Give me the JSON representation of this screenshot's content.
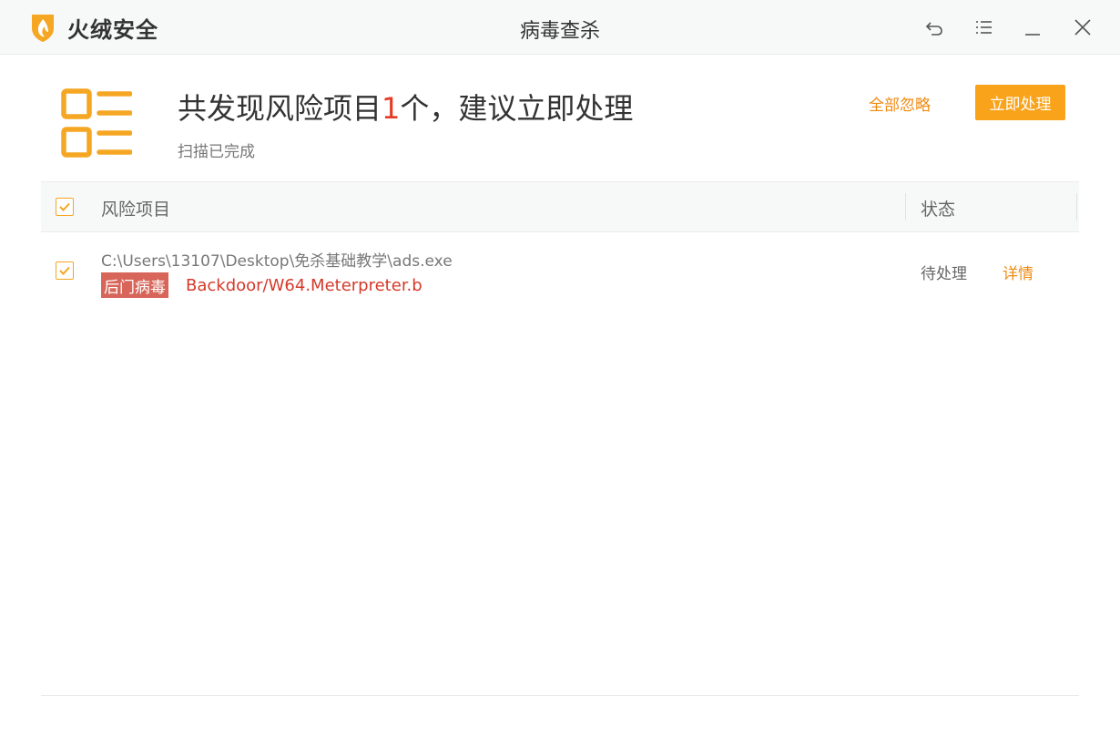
{
  "app": {
    "brand_name": "火绒安全",
    "window_title": "病毒查杀",
    "brand_color": "#f5a623"
  },
  "window_controls": {
    "back": "undo-arrow-icon",
    "menu": "menu-icon",
    "minimize": "minimize-icon",
    "close": "close-icon"
  },
  "summary": {
    "title_prefix": "共发现风险项目",
    "count": "1",
    "title_suffix": "个，建议立即处理",
    "subtitle": "扫描已完成",
    "ignore_all_label": "全部忽略",
    "process_now_label": "立即处理"
  },
  "table": {
    "header_checked": true,
    "columns": [
      "风险项目",
      "状态"
    ],
    "rows": [
      {
        "checked": true,
        "path": "C:\\Users\\13107\\Desktop\\免杀基础教学\\ads.exe",
        "tag": "后门病毒",
        "virus_name": "Backdoor/W64.Meterpreter.b",
        "status": "待处理",
        "action": "详情"
      }
    ]
  },
  "colors": {
    "accent": "#f9a31b",
    "link": "#f08a12",
    "danger": "#e53a26",
    "tag_bg": "#d7655a"
  }
}
